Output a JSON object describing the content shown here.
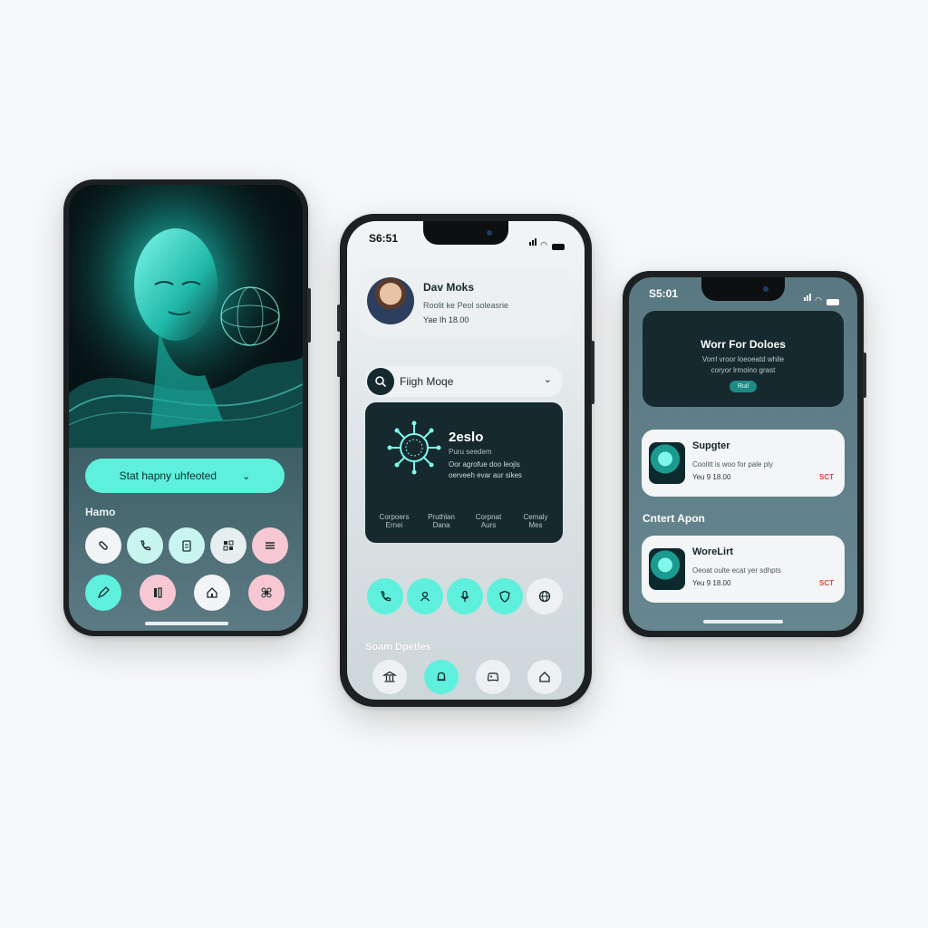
{
  "phone1": {
    "primary_button": "Stat hapny uhfeoted",
    "section_label": "Hamo",
    "action_icons_row1": [
      "pill-icon",
      "phone-icon",
      "clipboard-icon",
      "grid-icon",
      "menu-icon"
    ],
    "action_icons_row2": [
      "pen-icon",
      "book-icon",
      "home-icon",
      "flower-icon"
    ]
  },
  "phone2": {
    "status_time": "S6:51",
    "profile": {
      "name": "Dav Moks",
      "line1": "Roolit ke Peol soleasrie",
      "line2": "Yae Ih 18.00"
    },
    "search": {
      "value": "Fiigh Moqe"
    },
    "feature_card": {
      "title": "2eslo",
      "subtitle": "Puru seedem",
      "description_1": "Oor agrofue doo leojis",
      "description_2": "oerveeh evar aur sikes",
      "stats": [
        {
          "line1": "Corpoers",
          "line2": "Ernei"
        },
        {
          "line1": "Pruthlan",
          "line2": "Dana"
        },
        {
          "line1": "Corpnat",
          "line2": "Aurs"
        },
        {
          "line1": "Cemaly",
          "line2": "Mes"
        }
      ]
    },
    "action_icons": [
      "phone-icon",
      "user-icon",
      "mic-icon",
      "shield-icon",
      "globe-icon"
    ],
    "section_label": "Soam Dpetles",
    "nav_icons": [
      "bank-icon",
      "bell-icon",
      "gamepad-icon",
      "house-icon"
    ]
  },
  "phone3": {
    "status_time": "S5:01",
    "hero_card": {
      "title": "Worr For Doloes",
      "line1": "Vorrl vroor loeoeatd while",
      "line2": "coryor lrmoino grast",
      "button": "Ruil"
    },
    "items": [
      {
        "title": "Supgter",
        "desc": "Coolitt is woo for pale ply",
        "meta": "Yeu 9 18.00",
        "badge": "SCT"
      },
      {
        "title": "WoreLirt",
        "desc": "Oeoat oulte ecat yer sdhpts",
        "meta": "Yeu 9 18.00",
        "badge": "SCT"
      }
    ],
    "section_label": "Cntert Apon"
  },
  "colors": {
    "accent": "#5ef0dc",
    "dark_card": "#16292e",
    "pink": "#f7c8d4",
    "red_badge": "#e0453a",
    "steel": "#5f7d86"
  }
}
